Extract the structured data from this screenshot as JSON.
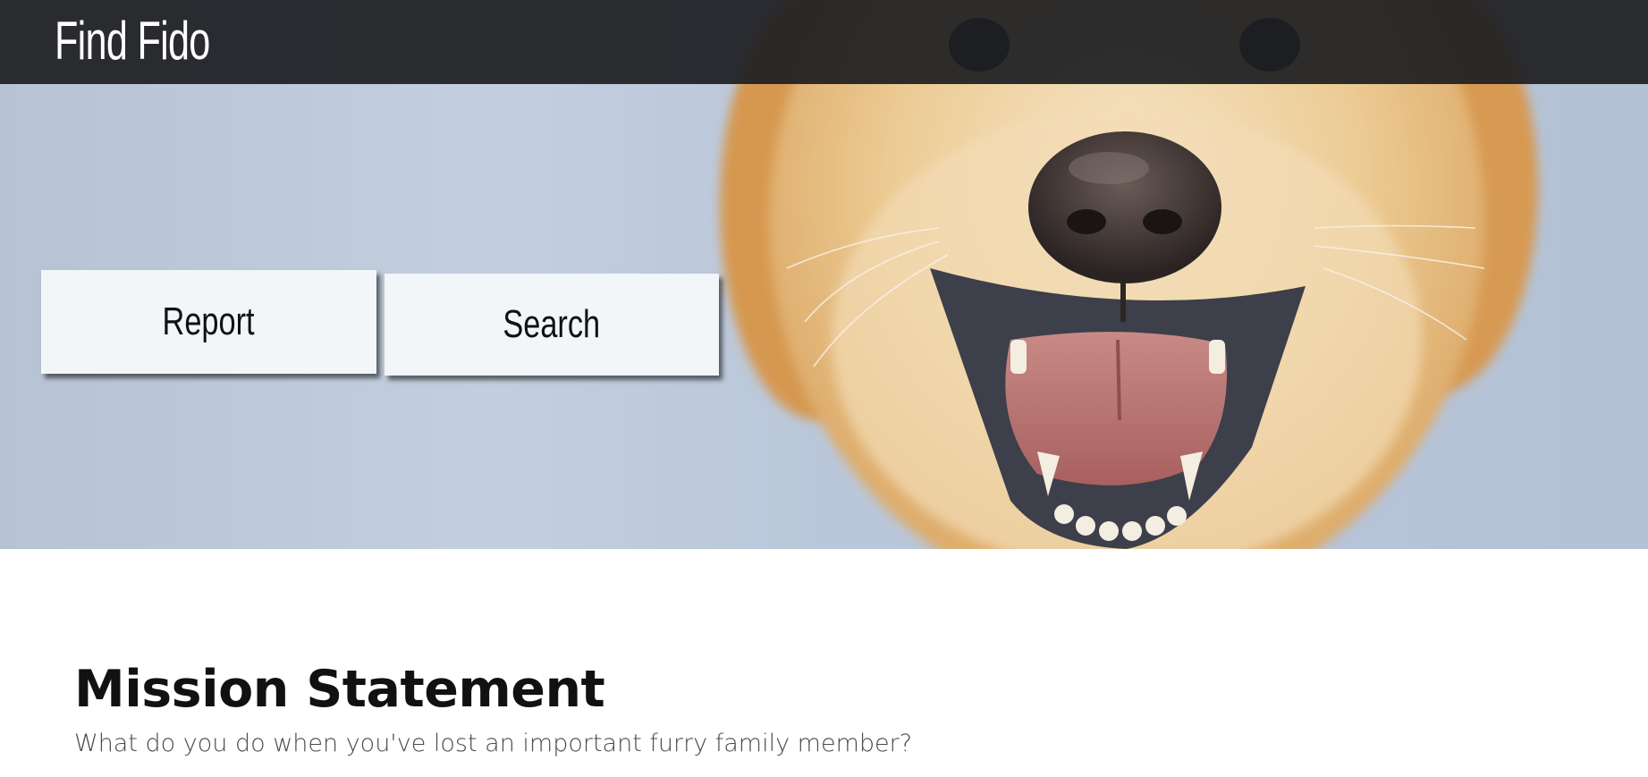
{
  "header": {
    "brand": "Find Fido"
  },
  "hero": {
    "image": "golden-retriever-photo",
    "buttons": {
      "report_label": "Report",
      "search_label": "Search"
    }
  },
  "mission": {
    "title": "Mission Statement",
    "text": "What do you do when you've lost an important furry family member?"
  },
  "colors": {
    "topbar": "#1e1f22",
    "button_bg": "#f2f6f8",
    "fur": "#e7bb7a",
    "backdrop": "#bfcadb"
  }
}
